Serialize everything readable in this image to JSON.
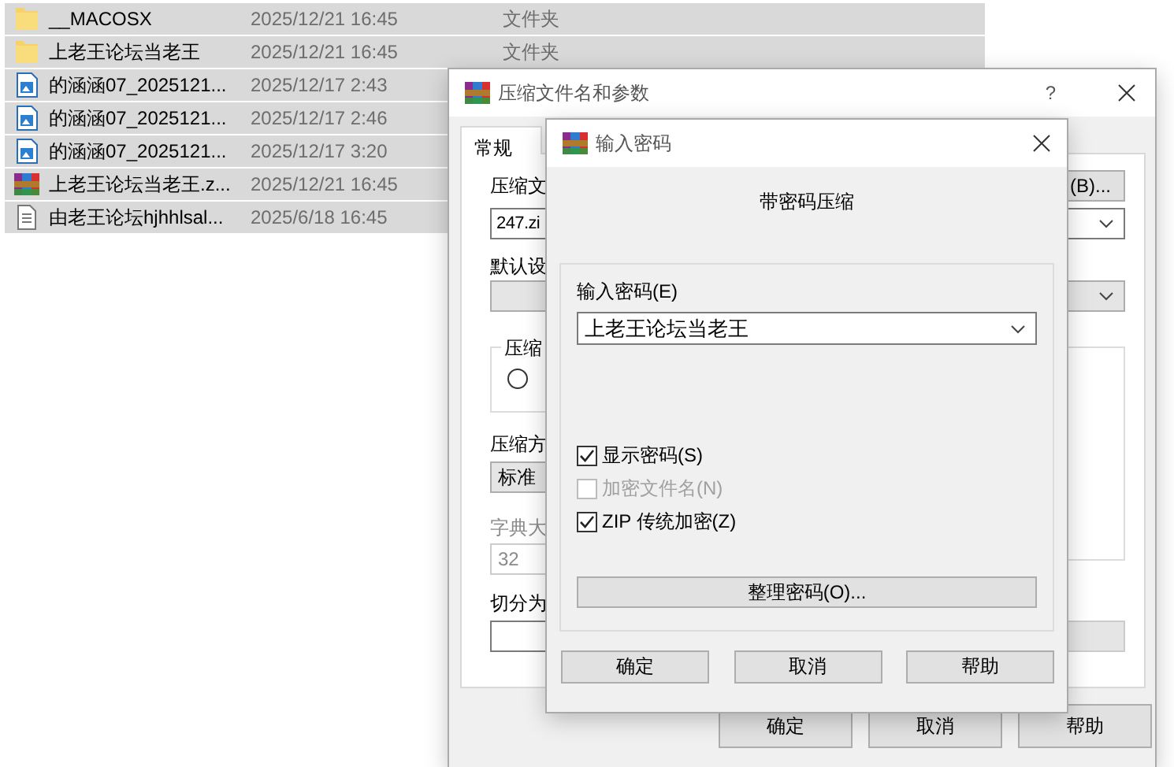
{
  "file_list": {
    "rows": [
      {
        "kind": "folder",
        "name": "__MACOSX",
        "date": "2025/12/21 16:45",
        "type": "文件夹",
        "selected": true
      },
      {
        "kind": "folder",
        "name": "上老王论坛当老王",
        "date": "2025/12/21 16:45",
        "type": "文件夹",
        "selected": true
      },
      {
        "kind": "image",
        "name": "的涵涵07_2025121...",
        "date": "2025/12/17 2:43",
        "selected": true
      },
      {
        "kind": "image",
        "name": "的涵涵07_2025121...",
        "date": "2025/12/17 2:46",
        "selected": true
      },
      {
        "kind": "image",
        "name": "的涵涵07_2025121...",
        "date": "2025/12/17 3:20",
        "selected": true
      },
      {
        "kind": "archive",
        "name": "上老王论坛当老王.z...",
        "date": "2025/12/21 16:45",
        "selected": true
      },
      {
        "kind": "text",
        "name": "由老王论坛hjhhlsal...",
        "date": "2025/6/18 16:45",
        "selected": true
      }
    ]
  },
  "archive_dialog": {
    "title": "压缩文件名和参数",
    "help": "?",
    "tabs": [
      {
        "label": "常规",
        "selected": true
      }
    ],
    "archive_name_label": "压缩文",
    "browse_button": "(B)...",
    "archive_name": "247.zi",
    "profile_label": "默认设",
    "format_group_label": "压缩",
    "format_radio": {
      "selected": false
    },
    "method_label": "压缩方",
    "method": "标准",
    "dictionary_label": "字典大",
    "dictionary": "32",
    "dictionary_disabled": true,
    "split_label": "切分为",
    "buttons": [
      "确定",
      "取消",
      "帮助"
    ]
  },
  "password_dialog": {
    "title": "输入密码",
    "heading": "带密码压缩",
    "password_label": "输入密码(E)",
    "password": "上老王论坛当老王",
    "options": [
      {
        "label": "显示密码(S)",
        "checked": true,
        "disabled": false
      },
      {
        "label": "加密文件名(N)",
        "checked": false,
        "disabled": true
      },
      {
        "label": "ZIP 传统加密(Z)",
        "checked": true,
        "disabled": false
      }
    ],
    "organize_button": "整理密码(O)...",
    "buttons": [
      "确定",
      "取消",
      "帮助"
    ]
  }
}
